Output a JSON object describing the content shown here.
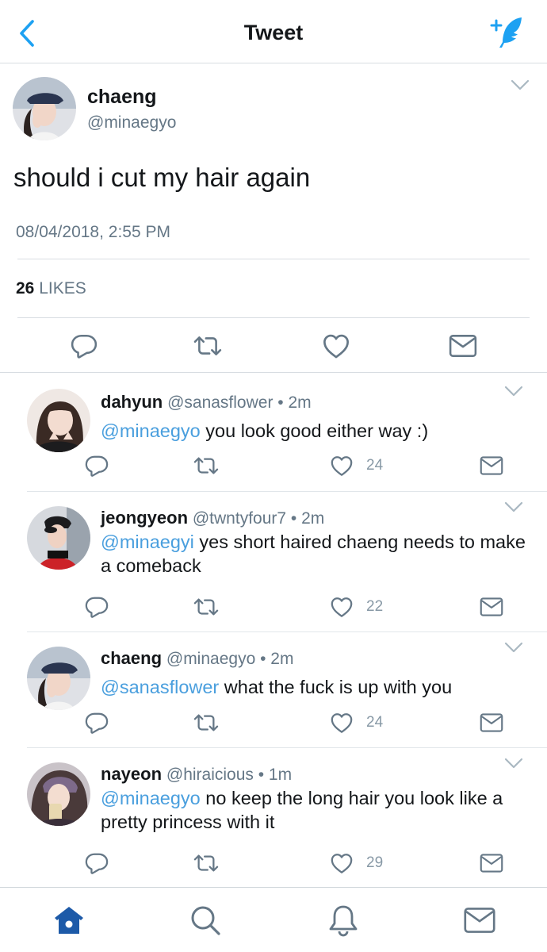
{
  "header": {
    "title": "Tweet",
    "back_icon": "chevron-left-icon",
    "compose_icon": "compose-tweet-icon",
    "accent_color": "#1da1f2"
  },
  "main_tweet": {
    "name": "chaeng",
    "handle": "@minaegyo",
    "text": "should i cut my hair again",
    "timestamp": "08/04/2018, 2:55 PM",
    "likes_count": "26",
    "likes_label": "LIKES"
  },
  "replies": [
    {
      "name": "dahyun",
      "handle": "@sanasflower",
      "time": "• 2m",
      "mention": "@minaegyo",
      "text": " you look good either way :)",
      "likes": "24"
    },
    {
      "name": "jeongyeon",
      "handle": "@twntyfour7",
      "time": "• 2m",
      "mention": "@minaegyi",
      "text": " yes short haired chaeng needs to make a comeback",
      "likes": "22"
    },
    {
      "name": "chaeng",
      "handle": "@minaegyo",
      "time": "• 2m",
      "mention": "@sanasflower",
      "text": " what the fuck is up with you",
      "likes": "24"
    },
    {
      "name": "nayeon",
      "handle": "@hiraicious",
      "time": "• 1m",
      "mention": "@minaegyo",
      "text": " no keep the long hair you look like a pretty princess with it",
      "likes": "29"
    }
  ],
  "tabs": [
    {
      "icon": "home-icon",
      "active": true
    },
    {
      "icon": "search-icon",
      "active": false
    },
    {
      "icon": "notifications-bell-icon",
      "active": false
    },
    {
      "icon": "messages-envelope-icon",
      "active": false
    }
  ]
}
